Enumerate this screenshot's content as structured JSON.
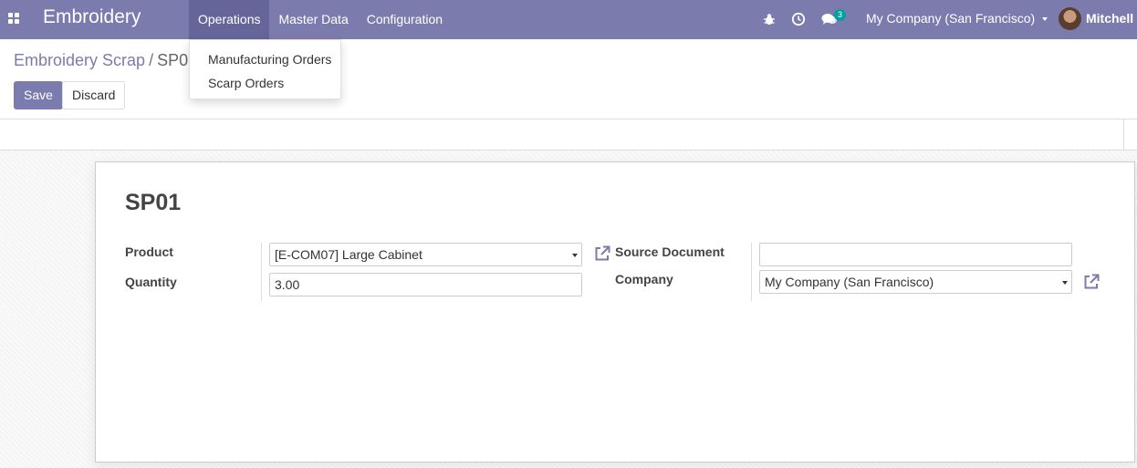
{
  "navbar": {
    "app_name": "Embroidery",
    "menu": [
      {
        "label": "Operations",
        "active": true
      },
      {
        "label": "Master Data",
        "active": false
      },
      {
        "label": "Configuration",
        "active": false
      }
    ],
    "messages_count": "3",
    "company": "My Company (San Francisco)",
    "user": "Mitchell A"
  },
  "dropdown": {
    "items": [
      "Manufacturing Orders",
      "Scarp Orders"
    ]
  },
  "breadcrumb": {
    "parent": "Embroidery Scrap",
    "separator": "/",
    "current": "SP01"
  },
  "buttons": {
    "save": "Save",
    "discard": "Discard"
  },
  "form": {
    "title": "SP01",
    "product_label": "Product",
    "product_value": "[E-COM07] Large Cabinet",
    "quantity_label": "Quantity",
    "quantity_value": "3.00",
    "source_document_label": "Source Document",
    "source_document_value": "",
    "company_label": "Company",
    "company_value": "My Company (San Francisco)"
  },
  "colors": {
    "brand": "#7c7bad",
    "badge": "#00a09d"
  }
}
